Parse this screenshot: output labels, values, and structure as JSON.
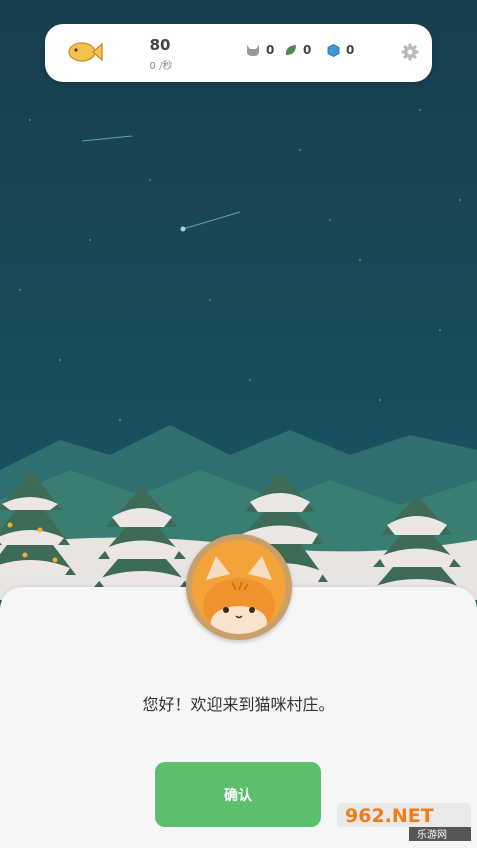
{
  "header": {
    "fish_value": "80",
    "fish_rate": "0 /秒",
    "resources": [
      {
        "icon": "cat-head-icon",
        "value": "0"
      },
      {
        "icon": "leaf-icon",
        "value": "0"
      },
      {
        "icon": "gem-icon",
        "value": "0"
      }
    ],
    "settings_icon": "gear-icon"
  },
  "dialog": {
    "avatar": "cat-avatar",
    "message": "您好！欢迎来到猫咪村庄。",
    "confirm_label": "确认"
  },
  "watermark": {
    "brand": "962.NET",
    "subtitle": "乐游网"
  },
  "colors": {
    "sky": "#184d5b",
    "confirm_button": "#5bbf6c",
    "panel": "#f6f6f6",
    "fish": "#f2c14e"
  }
}
